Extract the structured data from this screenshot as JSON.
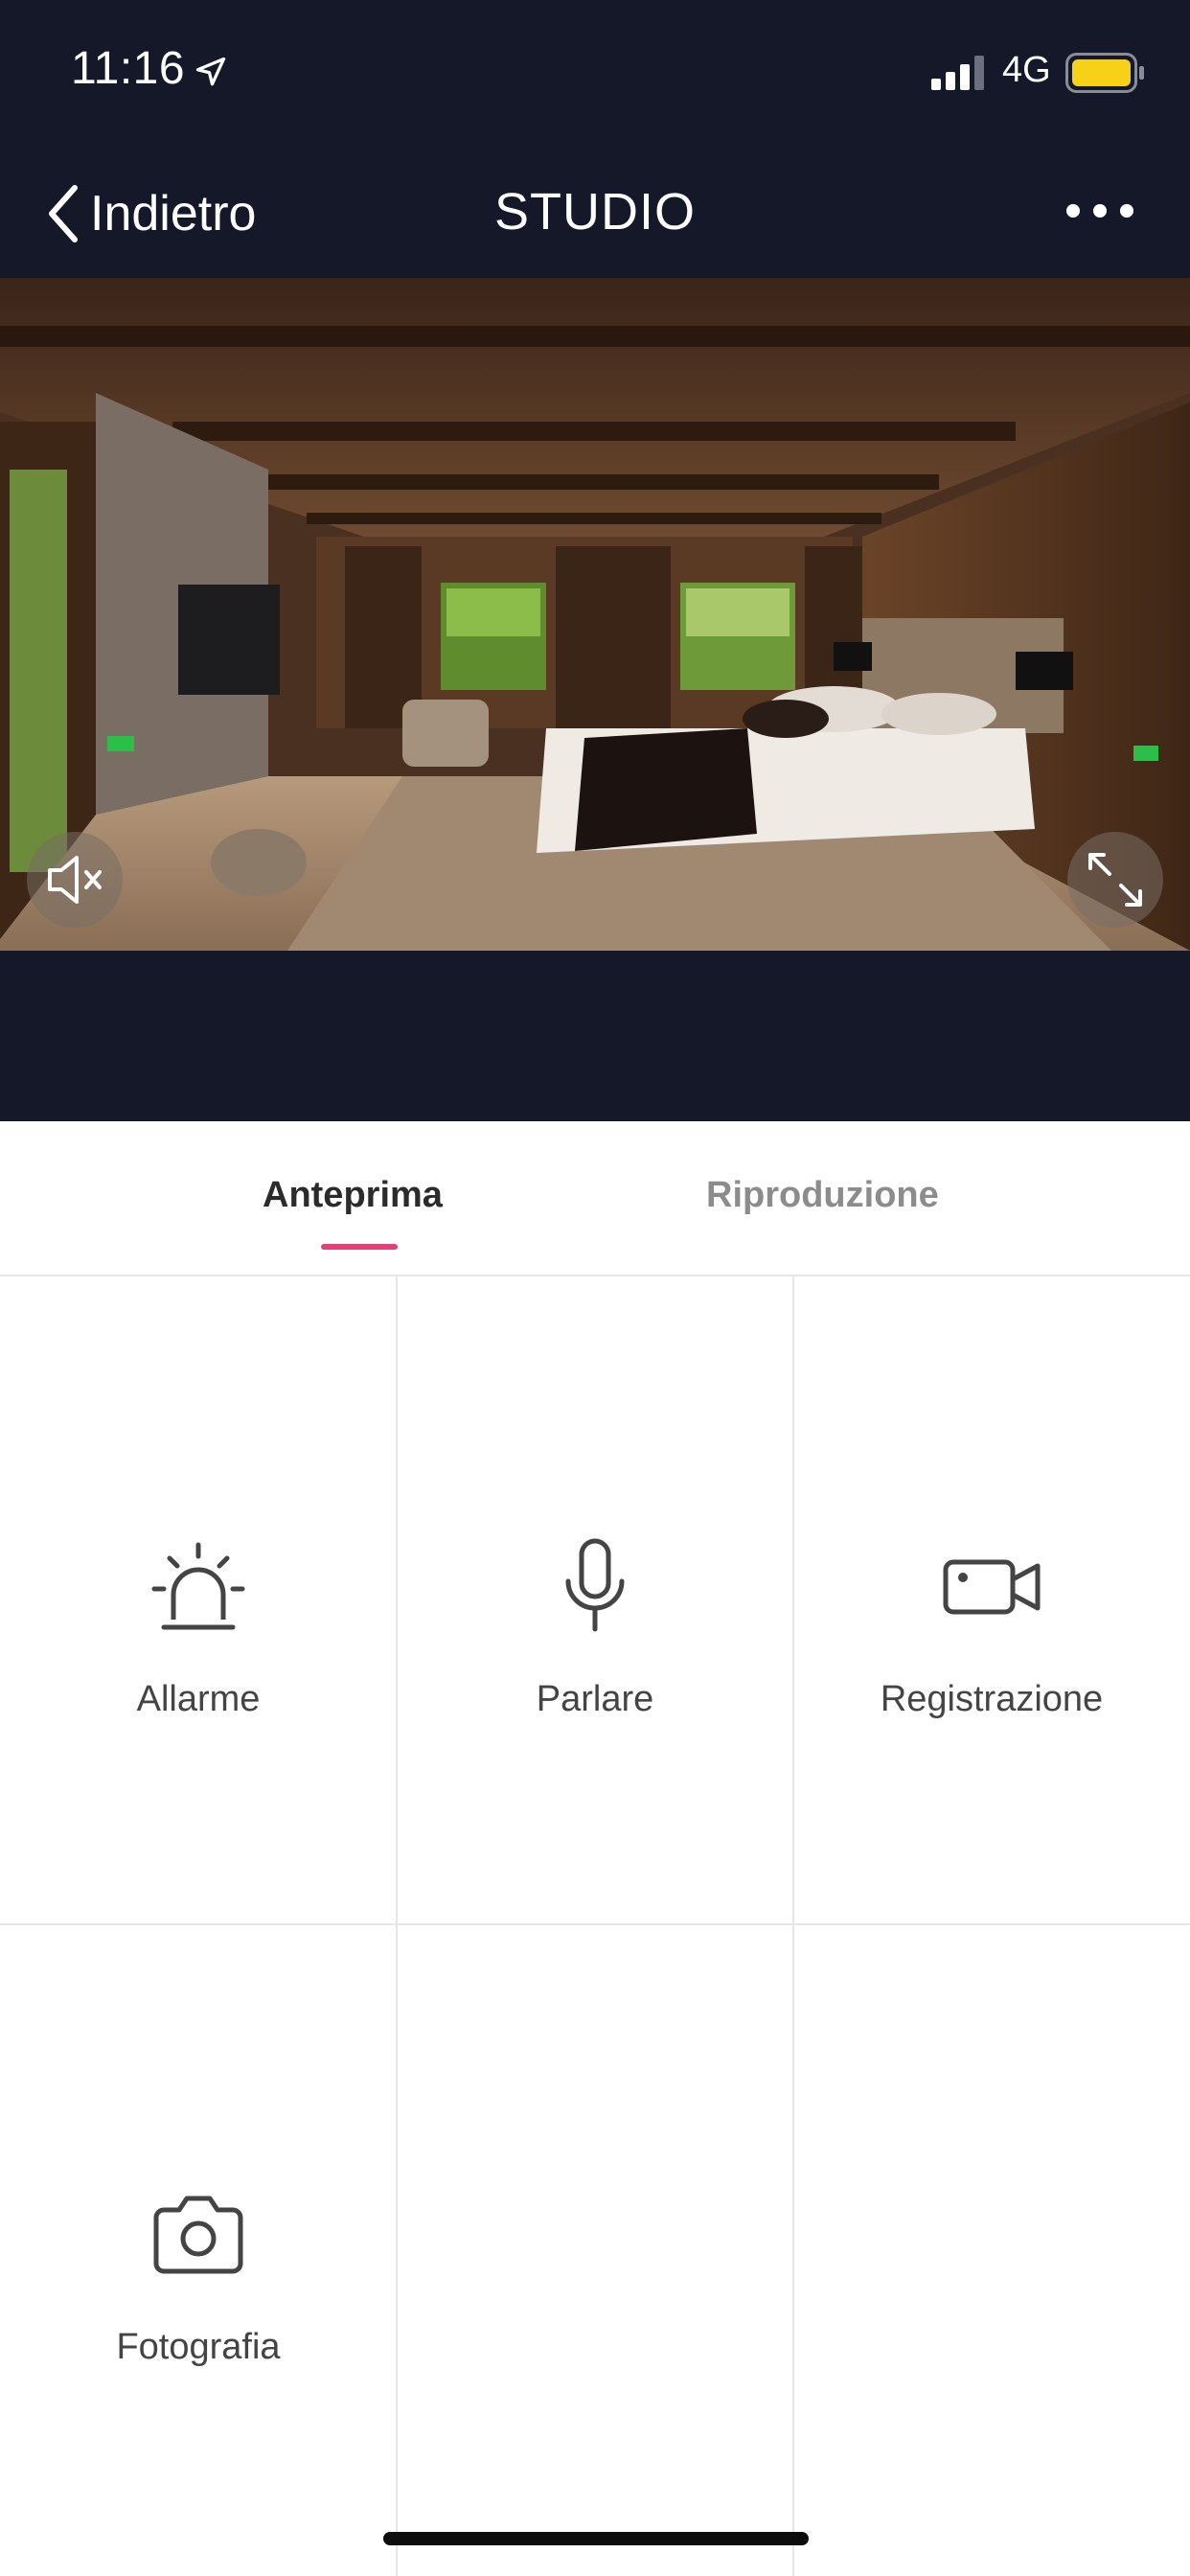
{
  "status_bar": {
    "time": "11:16",
    "network": "4G",
    "battery_color": "#f7d117"
  },
  "nav": {
    "back_label": "Indietro",
    "title": "STUDIO"
  },
  "tabs": [
    {
      "label": "Anteprima",
      "active": true
    },
    {
      "label": "Riproduzione",
      "active": false
    }
  ],
  "actions": [
    {
      "label": "Allarme",
      "icon": "alarm-light-icon"
    },
    {
      "label": "Parlare",
      "icon": "microphone-icon"
    },
    {
      "label": "Registrazione",
      "icon": "video-camera-icon"
    },
    {
      "label": "Fotografia",
      "icon": "photo-camera-icon"
    }
  ],
  "colors": {
    "header_bg": "#151829",
    "accent": "#e83e74"
  }
}
